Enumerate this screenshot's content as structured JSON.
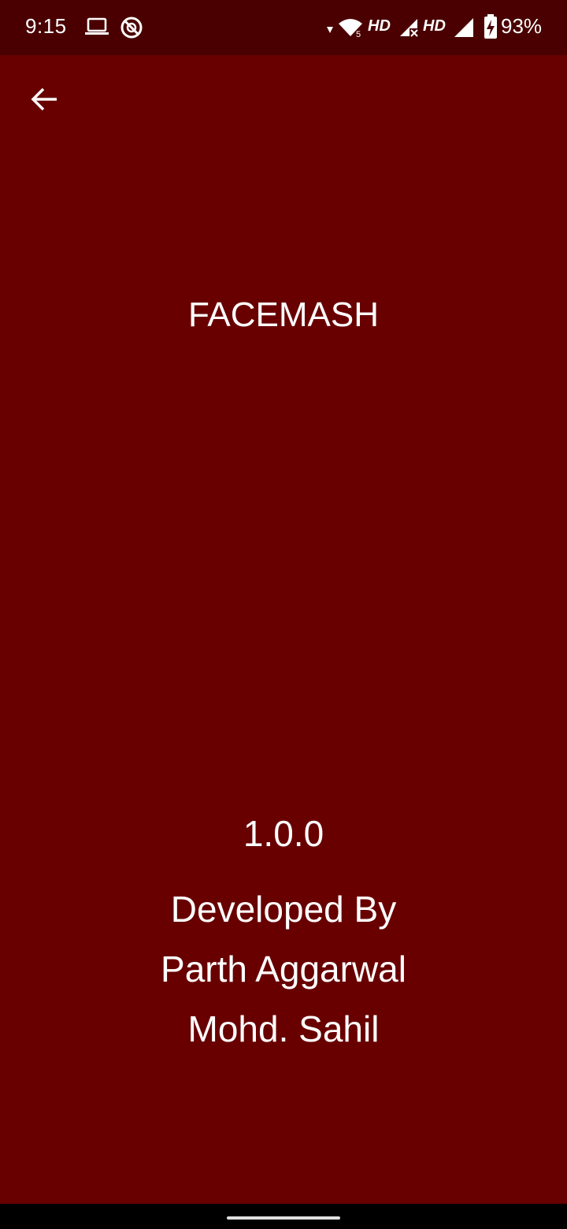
{
  "status_bar": {
    "time": "9:15",
    "hd_label_1": "HD",
    "hd_label_2": "HD",
    "battery_percent": "93%",
    "icons": [
      "laptop-icon",
      "do-not-disturb-icon",
      "wifi-icon",
      "signal-icon",
      "signal-icon",
      "battery-charging-icon"
    ]
  },
  "app_bar": {
    "back_icon": "arrow-left-icon"
  },
  "main": {
    "app_name": "FACEMASH",
    "version": "1.0.0",
    "credits": [
      "Developed By",
      "Parth Aggarwal",
      "Mohd. Sahil"
    ]
  },
  "colors": {
    "background": "#680000",
    "status_bar": "#4a0000",
    "text": "#ffffff"
  }
}
